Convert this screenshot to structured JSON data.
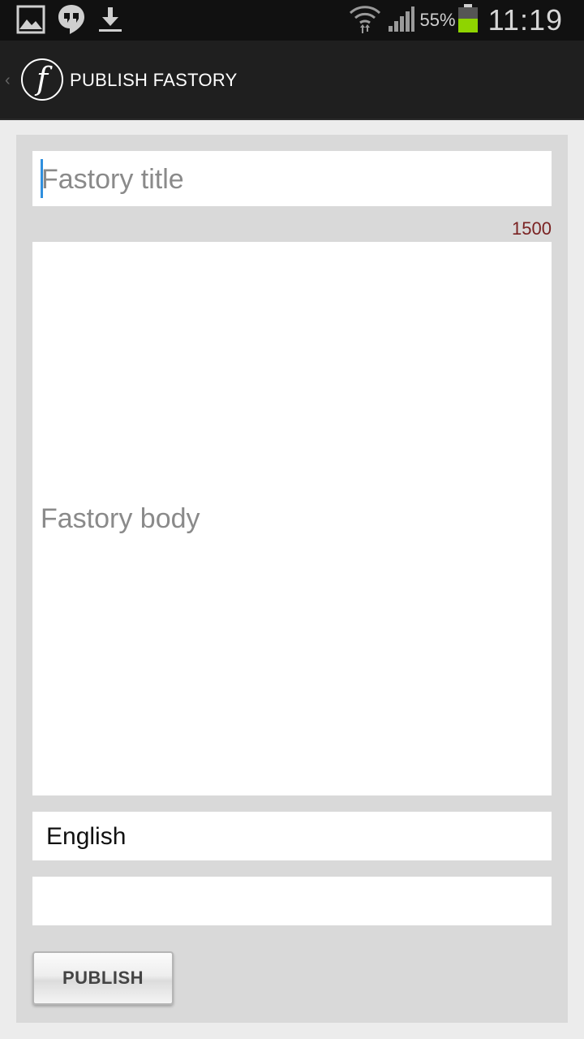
{
  "status_bar": {
    "icons_left": [
      "image-icon",
      "hangouts-icon",
      "download-icon"
    ],
    "battery_percent": "55%",
    "time": "11:19",
    "battery_color": "#8fd400"
  },
  "action_bar": {
    "logo_letter": "f",
    "title": "PUBLISH FASTORY"
  },
  "form": {
    "title_placeholder": "Fastory title",
    "char_counter": "1500",
    "body_placeholder": "Fastory body",
    "language_value": "English",
    "extra_value": "",
    "publish_label": "PUBLISH"
  },
  "colors": {
    "caret": "#2f8fde",
    "counter": "#7a2222",
    "actionbar": "#1f1f1f"
  }
}
